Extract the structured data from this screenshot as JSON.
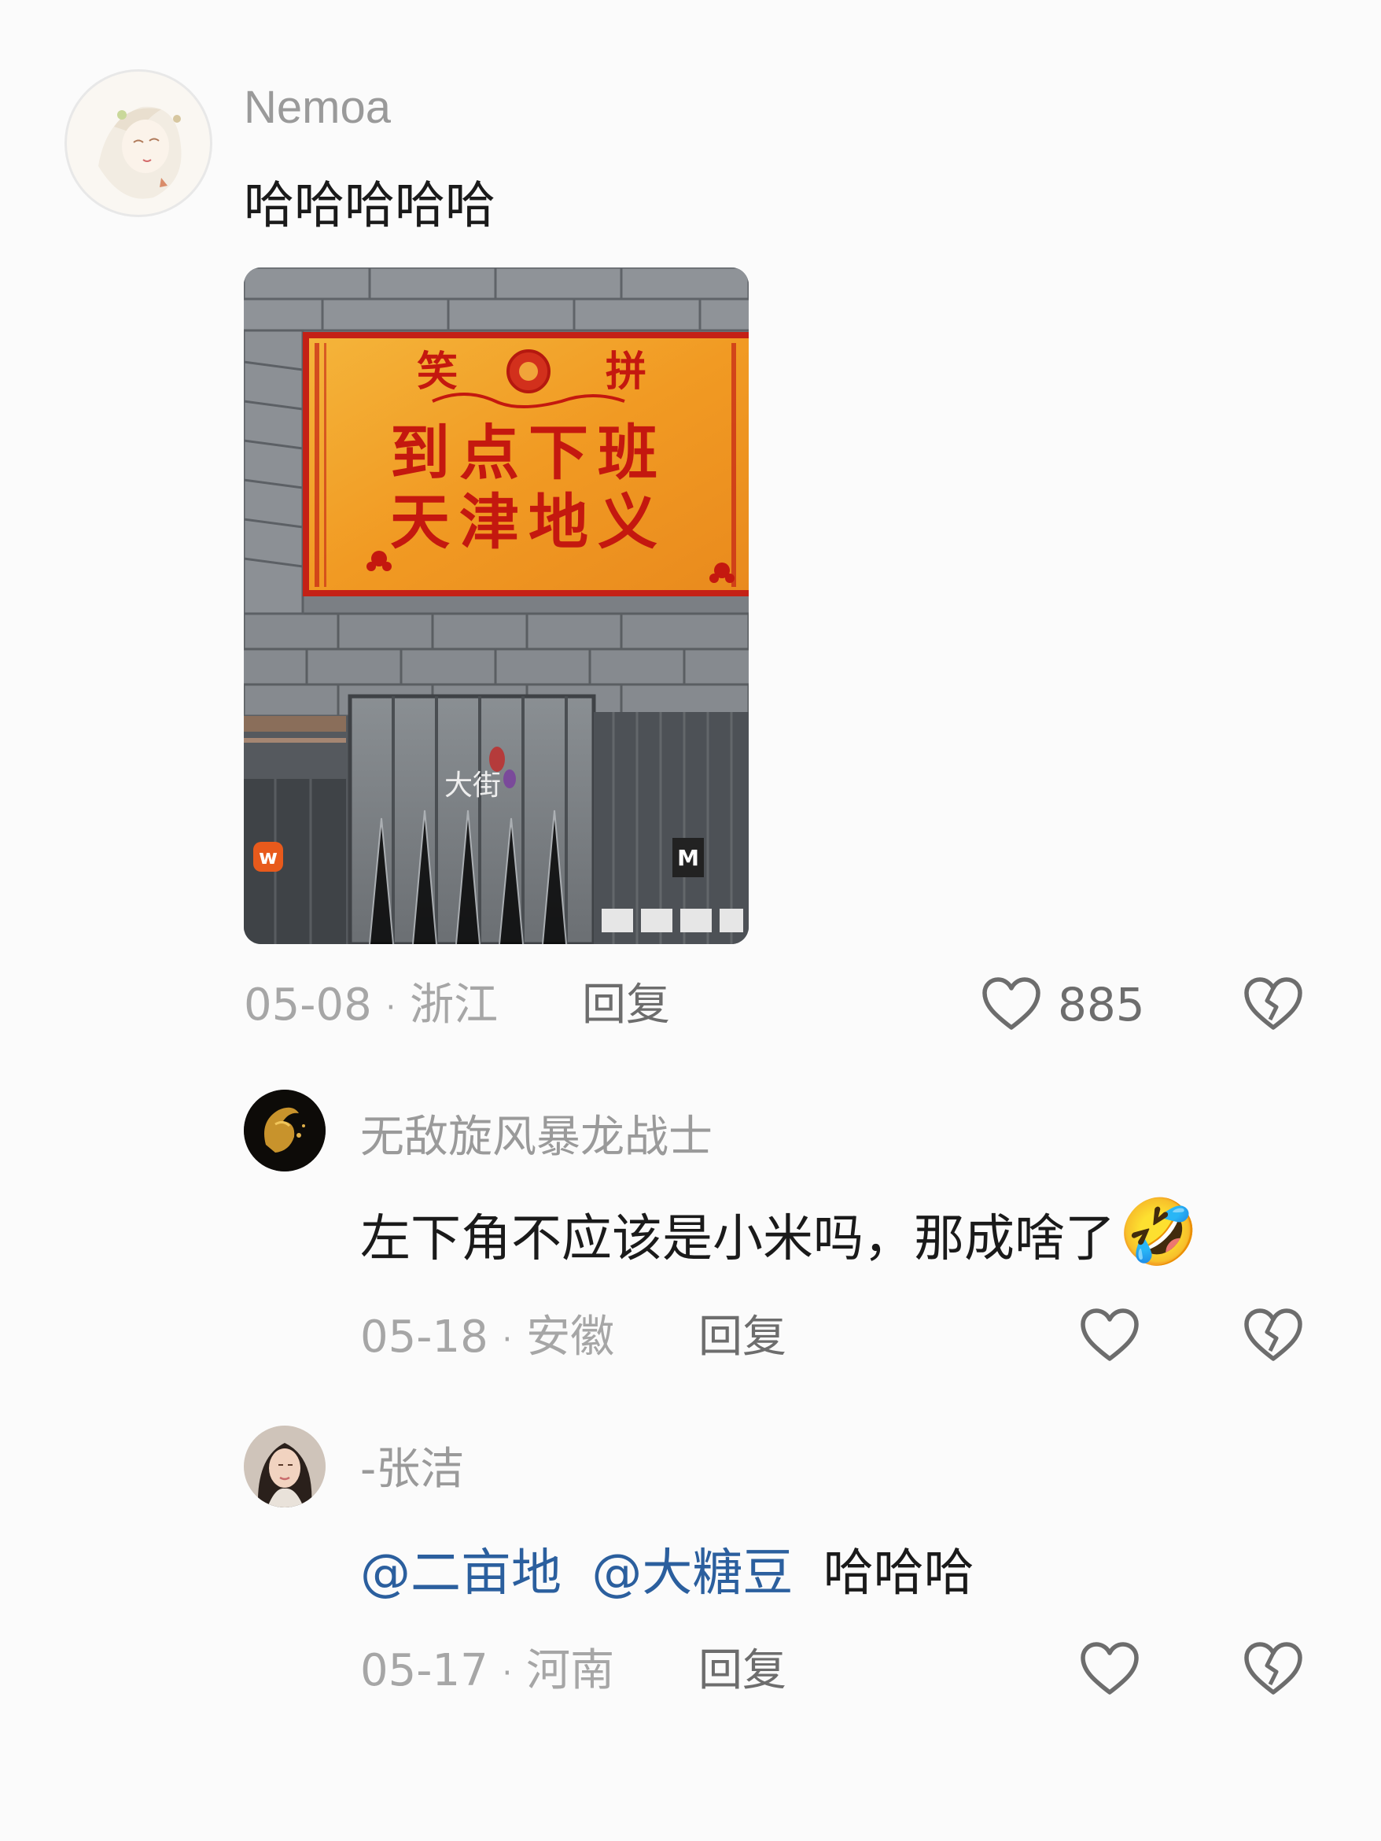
{
  "comments": [
    {
      "username": "Nemoa",
      "text": "哈哈哈哈哈",
      "image": {
        "sign_lines": [
          "到点下班",
          "天津地义"
        ],
        "sign_top_chars": [
          "笑",
          "拼"
        ],
        "mall_logo_text": "大街",
        "store_badge_left": "w",
        "store_badge_right": "M"
      },
      "date": "05-08",
      "location": "浙江",
      "reply_label": "回复",
      "like_count": "885"
    },
    {
      "username": "无敌旋风暴龙战士",
      "text": "左下角不应该是小米吗，那成啥了",
      "emoji": "🤣",
      "date": "05-18",
      "location": "安徽",
      "reply_label": "回复"
    },
    {
      "username": "-张洁",
      "mentions": [
        "@二亩地",
        "@大糖豆"
      ],
      "text": "哈哈哈",
      "date": "05-17",
      "location": "河南",
      "reply_label": "回复"
    }
  ],
  "meta_separator": "·",
  "icons": {
    "like": "heart-outline-icon",
    "dislike": "broken-heart-icon"
  },
  "colors": {
    "mention": "#2b5f9e",
    "meta": "#a6a6a6",
    "reply": "#6d6d6d",
    "sign_bg": "#f0a020",
    "sign_text": "#c4180f"
  }
}
